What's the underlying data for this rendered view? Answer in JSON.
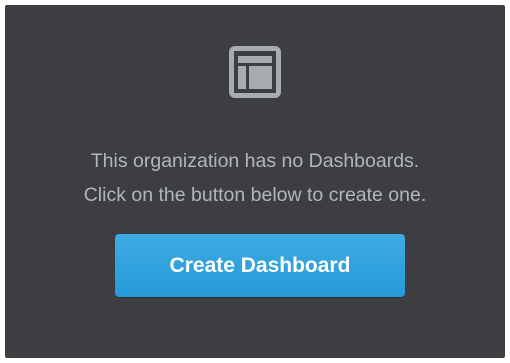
{
  "empty_state": {
    "icon": "dashboard-layout-icon",
    "message_line_1": "This organization has no Dashboards.",
    "message_line_2": "Click on the button below to create one.",
    "create_button_label": "Create Dashboard"
  },
  "colors": {
    "panel_background": "#3c3e42",
    "icon": "#a8acb1",
    "message_text": "#b2b6bb",
    "button_background": "#30a2df",
    "button_text": "#ffffff"
  }
}
